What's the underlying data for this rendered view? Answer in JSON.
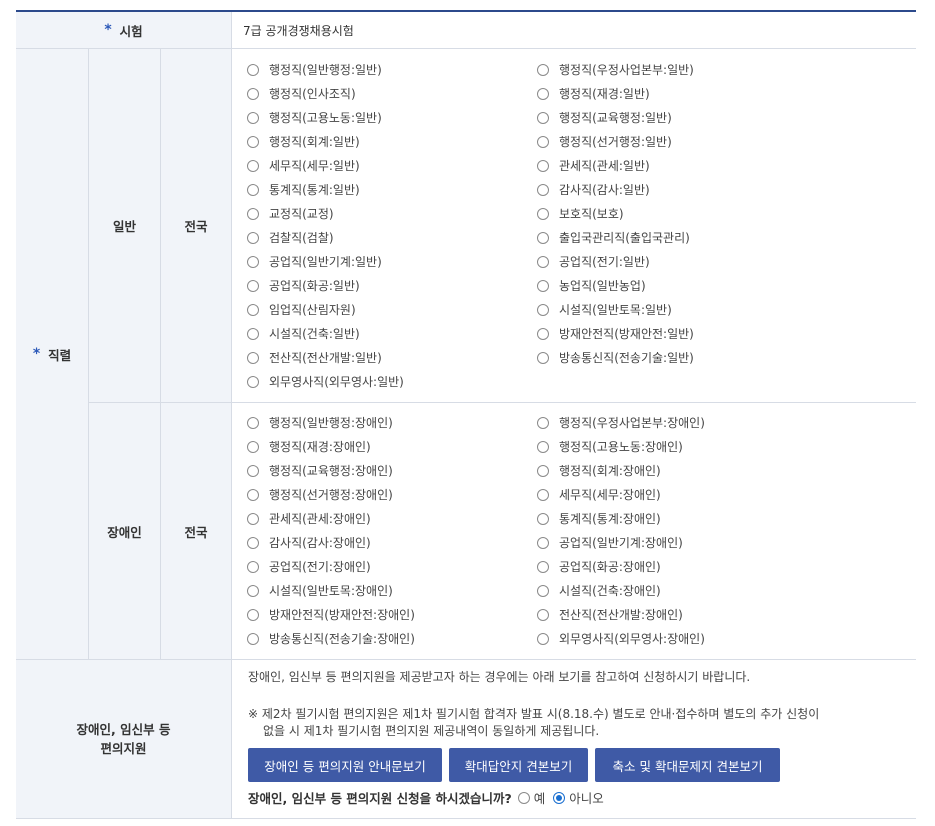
{
  "exam": {
    "label": "시험",
    "value": "7급 공개경쟁채용시험"
  },
  "position": {
    "label": "직렬",
    "general": {
      "category": "일반",
      "region": "전국",
      "left": [
        "행정직(일반행정:일반)",
        "행정직(인사조직)",
        "행정직(고용노동:일반)",
        "행정직(회계:일반)",
        "세무직(세무:일반)",
        "통계직(통계:일반)",
        "교정직(교정)",
        "검찰직(검찰)",
        "공업직(일반기계:일반)",
        "공업직(화공:일반)",
        "임업직(산림자원)",
        "시설직(건축:일반)",
        "전산직(전산개발:일반)",
        "외무영사직(외무영사:일반)"
      ],
      "right": [
        "행정직(우정사업본부:일반)",
        "행정직(재경:일반)",
        "행정직(교육행정:일반)",
        "행정직(선거행정:일반)",
        "관세직(관세:일반)",
        "감사직(감사:일반)",
        "보호직(보호)",
        "출입국관리직(출입국관리)",
        "공업직(전기:일반)",
        "농업직(일반농업)",
        "시설직(일반토목:일반)",
        "방재안전직(방재안전:일반)",
        "방송통신직(전송기술:일반)"
      ]
    },
    "disabled": {
      "category": "장애인",
      "region": "전국",
      "left": [
        "행정직(일반행정:장애인)",
        "행정직(재경:장애인)",
        "행정직(교육행정:장애인)",
        "행정직(선거행정:장애인)",
        "관세직(관세:장애인)",
        "감사직(감사:장애인)",
        "공업직(전기:장애인)",
        "시설직(일반토목:장애인)",
        "방재안전직(방재안전:장애인)",
        "방송통신직(전송기술:장애인)"
      ],
      "right": [
        "행정직(우정사업본부:장애인)",
        "행정직(고용노동:장애인)",
        "행정직(회계:장애인)",
        "세무직(세무:장애인)",
        "통계직(통계:장애인)",
        "공업직(일반기계:장애인)",
        "공업직(화공:장애인)",
        "시설직(건축:장애인)",
        "전산직(전산개발:장애인)",
        "외무영사직(외무영사:장애인)"
      ]
    }
  },
  "support": {
    "label_line1": "장애인, 임신부 등",
    "label_line2": "편의지원",
    "intro": "장애인, 임신부 등 편의지원을 제공받고자 하는 경우에는 아래 보기를 참고하여 신청하시기 바랍니다.",
    "note_line1": "※ 제2차 필기시험 편의지원은 제1차 필기시험 합격자 발표 시(8.18.수) 별도로 안내·접수하며 별도의 추가 신청이",
    "note_line2": "없을 시 제1차 필기시험 편의지원 제공내역이 동일하게 제공됩니다.",
    "buttons": [
      "장애인 등 편의지원 안내문보기",
      "확대답안지 견본보기",
      "축소 및 확대문제지 견본보기"
    ],
    "question": "장애인, 임신부 등 편의지원 신청을 하시겠습니까?",
    "yes_label": "예",
    "no_label": "아니오",
    "selected": "아니오"
  },
  "colors": {
    "accent": "#3f5aa6",
    "header_bg": "#f1f4f9",
    "star": "#2b58b8",
    "top_border": "#2c4a8c"
  }
}
